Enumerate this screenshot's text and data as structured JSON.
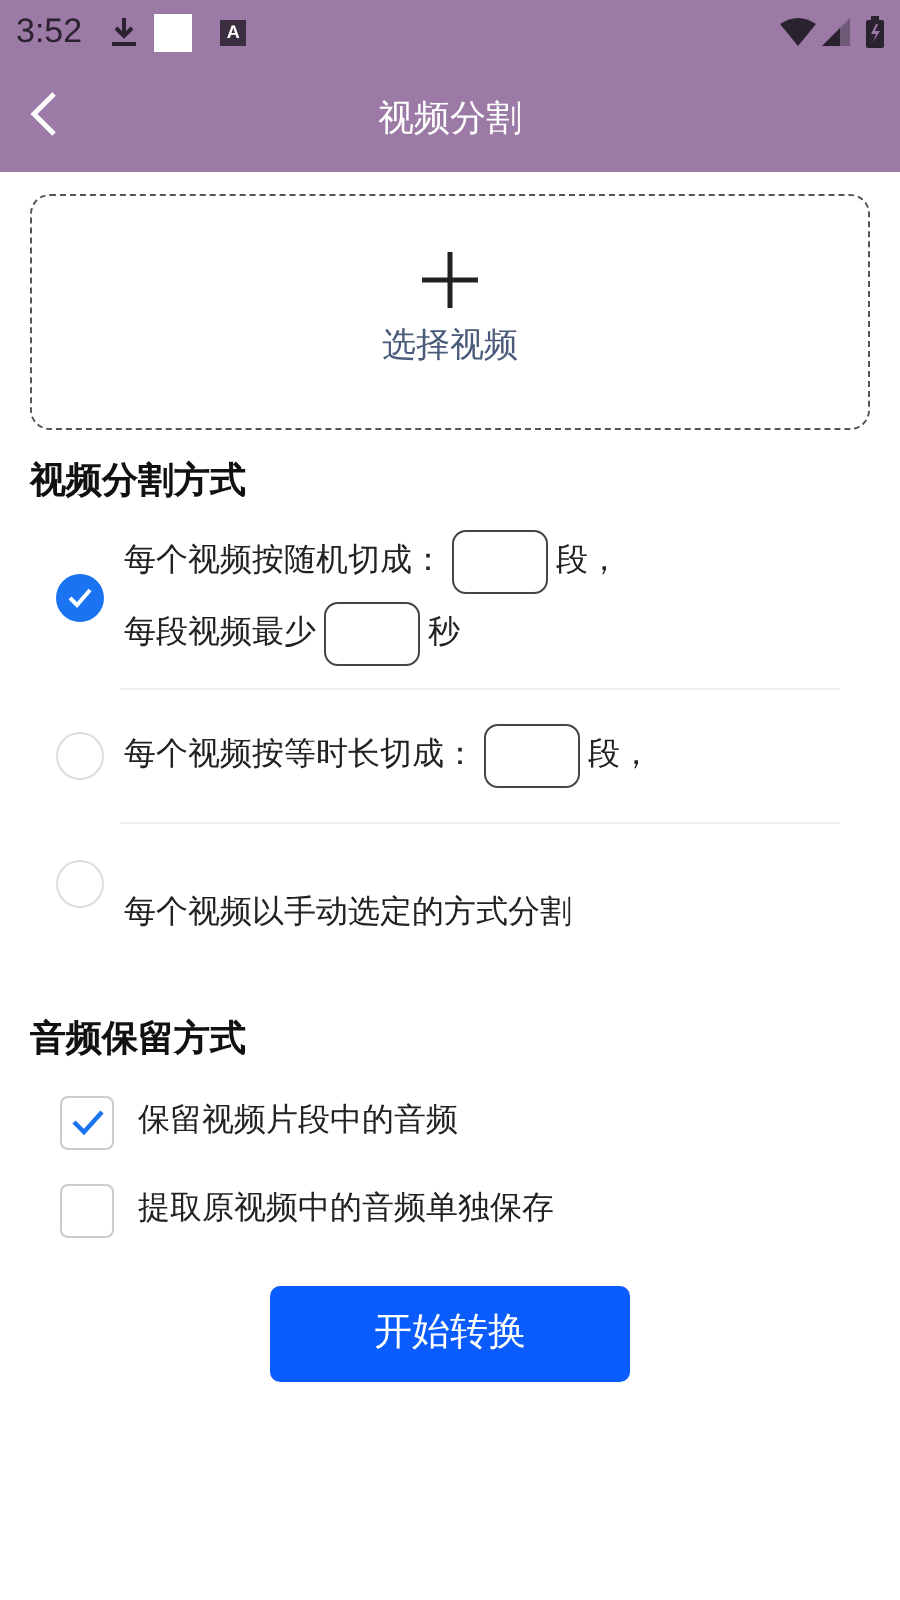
{
  "status_bar": {
    "time": "3:52",
    "badge_letter": "A"
  },
  "header": {
    "title": "视频分割"
  },
  "upload": {
    "label": "选择视频"
  },
  "split_section": {
    "title": "视频分割方式",
    "options": [
      {
        "selected": true,
        "lines": [
          [
            {
              "kind": "text",
              "text": "每个视频按随机切成："
            },
            {
              "kind": "field"
            },
            {
              "kind": "text",
              "text": "段，"
            }
          ],
          [
            {
              "kind": "text",
              "text": "每段视频最少"
            },
            {
              "kind": "field"
            },
            {
              "kind": "text",
              "text": "秒"
            }
          ]
        ]
      },
      {
        "selected": false,
        "lines": [
          [
            {
              "kind": "text",
              "text": "每个视频按等时长切成："
            },
            {
              "kind": "field"
            },
            {
              "kind": "text",
              "text": "段，"
            }
          ]
        ]
      },
      {
        "selected": false,
        "lines": [
          [
            {
              "kind": "text",
              "text": "每个视频以手动选定的方式分割"
            }
          ]
        ]
      }
    ]
  },
  "audio_section": {
    "title": "音频保留方式",
    "options": [
      {
        "label": "保留视频片段中的音频",
        "checked": true
      },
      {
        "label": "提取原视频中的音频单独保存",
        "checked": false
      }
    ]
  },
  "start_button": {
    "label": "开始转换"
  }
}
